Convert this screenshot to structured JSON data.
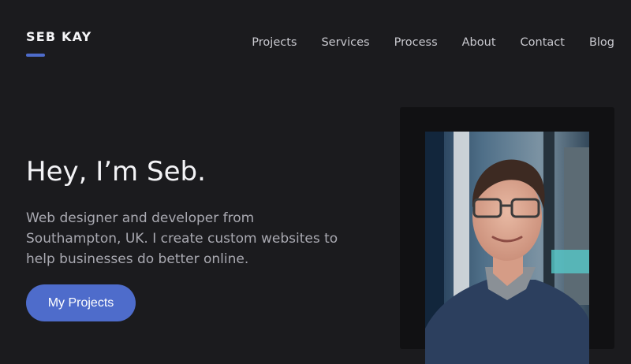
{
  "brand": {
    "name": "SEB KAY",
    "accent": "#4e6ccb"
  },
  "nav": {
    "items": [
      {
        "label": "Projects"
      },
      {
        "label": "Services"
      },
      {
        "label": "Process"
      },
      {
        "label": "About"
      },
      {
        "label": "Contact"
      },
      {
        "label": "Blog"
      }
    ]
  },
  "hero": {
    "headline": "Hey, I’m Seb.",
    "intro": "Web designer and developer from Southampton, UK. I create custom websites to help businesses do better online.",
    "cta_label": "My Projects"
  },
  "colors": {
    "background": "#1b1b1e",
    "frame": "#111113",
    "sweater": "#2c3f5e"
  }
}
